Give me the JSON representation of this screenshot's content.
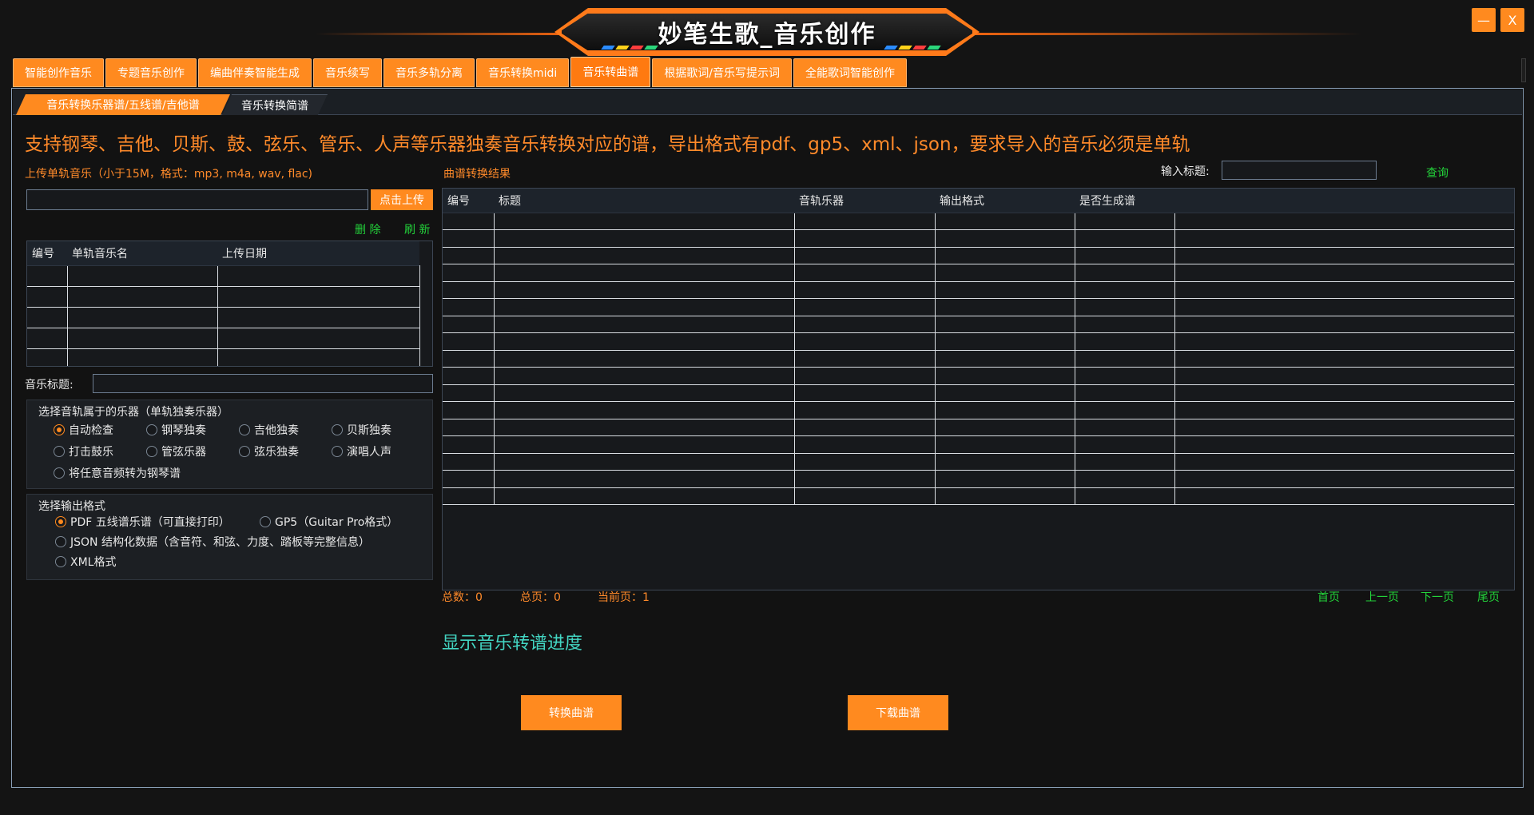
{
  "app": {
    "title": "妙笔生歌_音乐创作",
    "minimize": "—",
    "close": "X"
  },
  "top_tabs": [
    "智能创作音乐",
    "专题音乐创作",
    "编曲伴奏智能生成",
    "音乐续写",
    "音乐多轨分离",
    "音乐转换midi",
    "音乐转曲谱",
    "根据歌词/音乐写提示词",
    "全能歌词智能创作"
  ],
  "active_top_tab": "音乐转曲谱",
  "sub_tabs": [
    "音乐转换乐器谱/五线谱/吉他谱",
    "音乐转换简谱"
  ],
  "description": "支持钢琴、吉他、贝斯、鼓、弦乐、管乐、人声等乐器独奏音乐转换对应的谱，导出格式有pdf、gp5、xml、json，要求导入的音乐必须是单轨",
  "upload": {
    "label": "上传单轨音乐（小于15M，格式：mp3, m4a, wav, flac)",
    "value": "",
    "button": "点击上传",
    "delete": "删 除",
    "refresh": "刷 新"
  },
  "upload_table": {
    "columns": [
      "编号",
      "单轨音乐名",
      "上传日期"
    ],
    "rows": [
      [
        "",
        "",
        ""
      ],
      [
        "",
        "",
        ""
      ],
      [
        "",
        "",
        ""
      ],
      [
        "",
        "",
        ""
      ],
      [
        "",
        "",
        ""
      ]
    ]
  },
  "music_title": {
    "label": "音乐标题:",
    "value": ""
  },
  "instrument_group": {
    "title": "选择音轨属于的乐器（单轨独奏乐器）",
    "options": [
      "自动检查",
      "钢琴独奏",
      "吉他独奏",
      "贝斯独奏",
      "打击鼓乐",
      "管弦乐器",
      "弦乐独奏",
      "演唱人声",
      "将任意音频转为钢琴谱"
    ],
    "selected": "自动检查"
  },
  "format_group": {
    "title": "选择输出格式",
    "options": [
      "PDF 五线谱乐谱（可直接打印）",
      "GP5（Guitar Pro格式）",
      "JSON 结构化数据（含音符、和弦、力度、踏板等完整信息）",
      "XML格式"
    ],
    "selected": "PDF 五线谱乐谱（可直接打印）"
  },
  "results": {
    "label": "曲谱转换结果",
    "search_label": "输入标题:",
    "search_value": "",
    "query": "查询",
    "columns": [
      "编号",
      "标题",
      "音轨乐器",
      "输出格式",
      "是否生成谱",
      ""
    ],
    "row_count": 17
  },
  "pager": {
    "total": "总数：0",
    "pages": "总页：0",
    "current": "当前页：1",
    "first": "首页",
    "prev": "上一页",
    "next": "下一页",
    "last": "尾页"
  },
  "progress_text": "显示音乐转谱进度",
  "actions": {
    "convert": "转换曲谱",
    "download": "下载曲谱"
  },
  "colors": {
    "accent": "#ff8a1f",
    "green": "#23d23a",
    "teal": "#43d6c3",
    "background": "#141414"
  }
}
